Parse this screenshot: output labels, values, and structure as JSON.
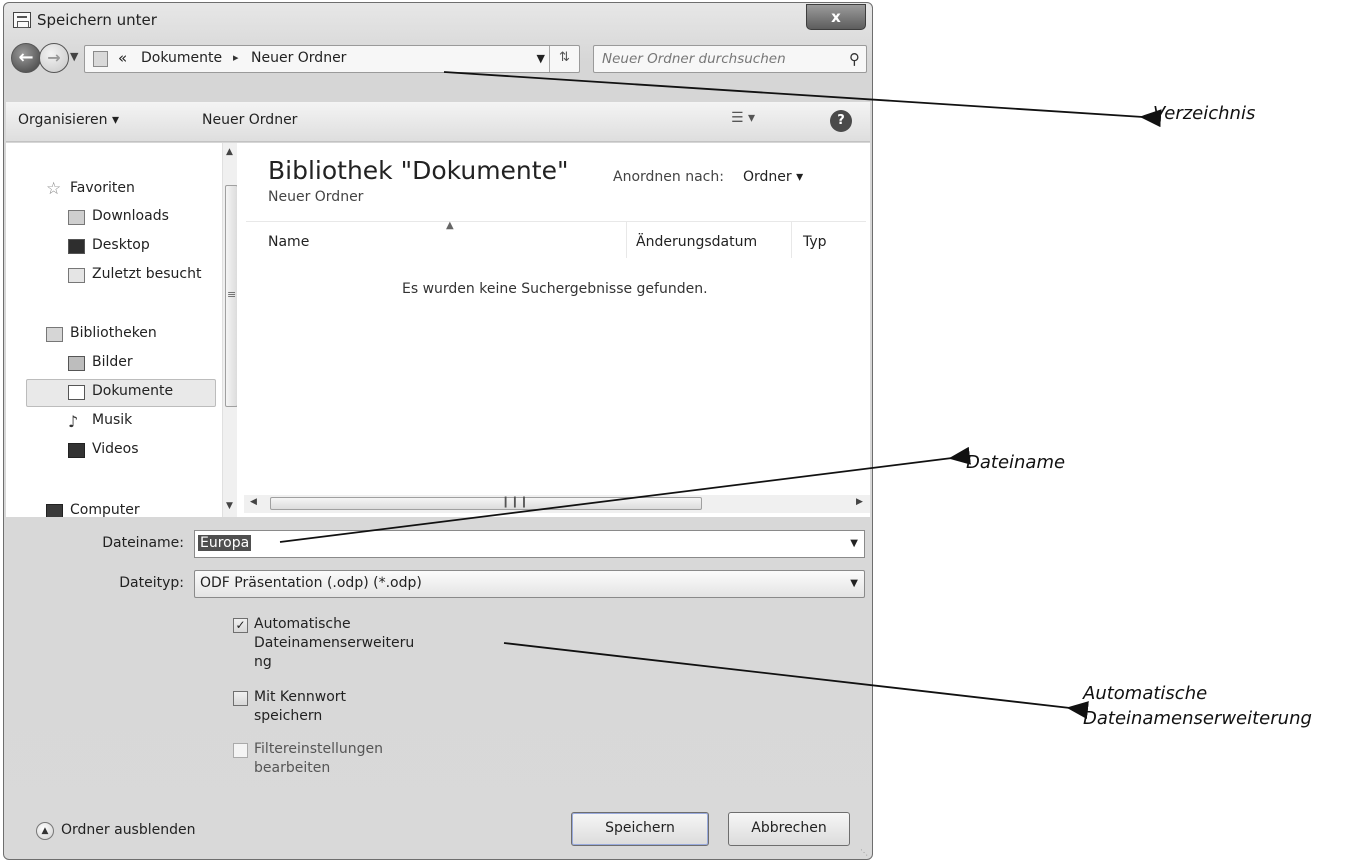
{
  "window": {
    "title": "Speichern unter",
    "close_label": "x"
  },
  "address": {
    "chevron": "«",
    "crumbs": [
      "Dokumente",
      "Neuer Ordner"
    ],
    "separator": "▸"
  },
  "search": {
    "placeholder": "Neuer Ordner durchsuchen"
  },
  "toolbar": {
    "organize_label": "Organisieren ▾",
    "new_folder_label": "Neuer Ordner"
  },
  "sidebar": {
    "items": [
      {
        "label": "Favoriten",
        "icon": "star-icon"
      },
      {
        "label": "Downloads",
        "icon": "downloads-folder-icon"
      },
      {
        "label": "Desktop",
        "icon": "desktop-icon"
      },
      {
        "label": "Zuletzt besucht",
        "icon": "recent-places-icon"
      },
      {
        "label": "Bibliotheken",
        "icon": "libraries-icon"
      },
      {
        "label": "Bilder",
        "icon": "pictures-icon"
      },
      {
        "label": "Dokumente",
        "icon": "documents-icon",
        "selected": true
      },
      {
        "label": "Musik",
        "icon": "music-icon"
      },
      {
        "label": "Videos",
        "icon": "videos-icon"
      },
      {
        "label": "Computer",
        "icon": "computer-icon"
      }
    ]
  },
  "library": {
    "title": "Bibliothek \"Dokumente\"",
    "subtitle": "Neuer Ordner",
    "arrange_label": "Anordnen nach:",
    "arrange_value": "Ordner ▾"
  },
  "columns": {
    "name": "Name",
    "date": "Änderungsdatum",
    "type": "Typ"
  },
  "results": {
    "empty_message": "Es wurden keine Suchergebnisse gefunden."
  },
  "form": {
    "filename_label": "Dateiname:",
    "filename_value": "Europa",
    "filetype_label": "Dateityp:",
    "filetype_value": "ODF Präsentation (.odp) (*.odp)"
  },
  "options": {
    "auto_ext": {
      "lines": [
        "Automatische",
        "Dateinamenserweiteru",
        "ng"
      ],
      "checked": true
    },
    "password": {
      "lines": [
        "Mit Kennwort",
        "speichern"
      ],
      "checked": false
    },
    "filter": {
      "lines": [
        "Filtereinstellungen",
        "bearbeiten"
      ],
      "checked": false,
      "enabled": false
    }
  },
  "footer": {
    "hide_folders_label": "Ordner ausblenden",
    "save_label": "Speichern",
    "cancel_label": "Abbrechen"
  },
  "annotations": {
    "directory": "Verzeichnis",
    "filename": "Dateiname",
    "auto_ext_line1": "Automatische",
    "auto_ext_line2": "Dateinamenserweiterung"
  }
}
